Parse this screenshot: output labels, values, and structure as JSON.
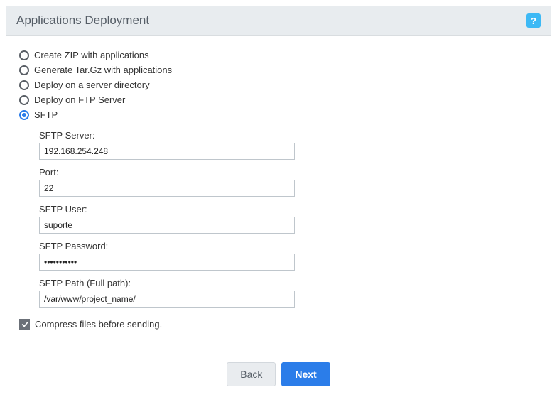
{
  "header": {
    "title": "Applications Deployment",
    "help_glyph": "?"
  },
  "radios": [
    {
      "label": "Create ZIP with applications",
      "selected": false
    },
    {
      "label": "Generate Tar.Gz with applications",
      "selected": false
    },
    {
      "label": "Deploy on a server directory",
      "selected": false
    },
    {
      "label": "Deploy on FTP Server",
      "selected": false
    },
    {
      "label": "SFTP",
      "selected": true
    }
  ],
  "form": {
    "server_label": "SFTP Server:",
    "server_value": "192.168.254.248",
    "port_label": "Port:",
    "port_value": "22",
    "user_label": "SFTP User:",
    "user_value": "suporte",
    "password_label": "SFTP Password:",
    "password_value": "•••••••••••",
    "path_label": "SFTP Path (Full path):",
    "path_value": "/var/www/project_name/"
  },
  "checkbox": {
    "label": "Compress files before sending.",
    "checked": true
  },
  "buttons": {
    "back": "Back",
    "next": "Next"
  }
}
